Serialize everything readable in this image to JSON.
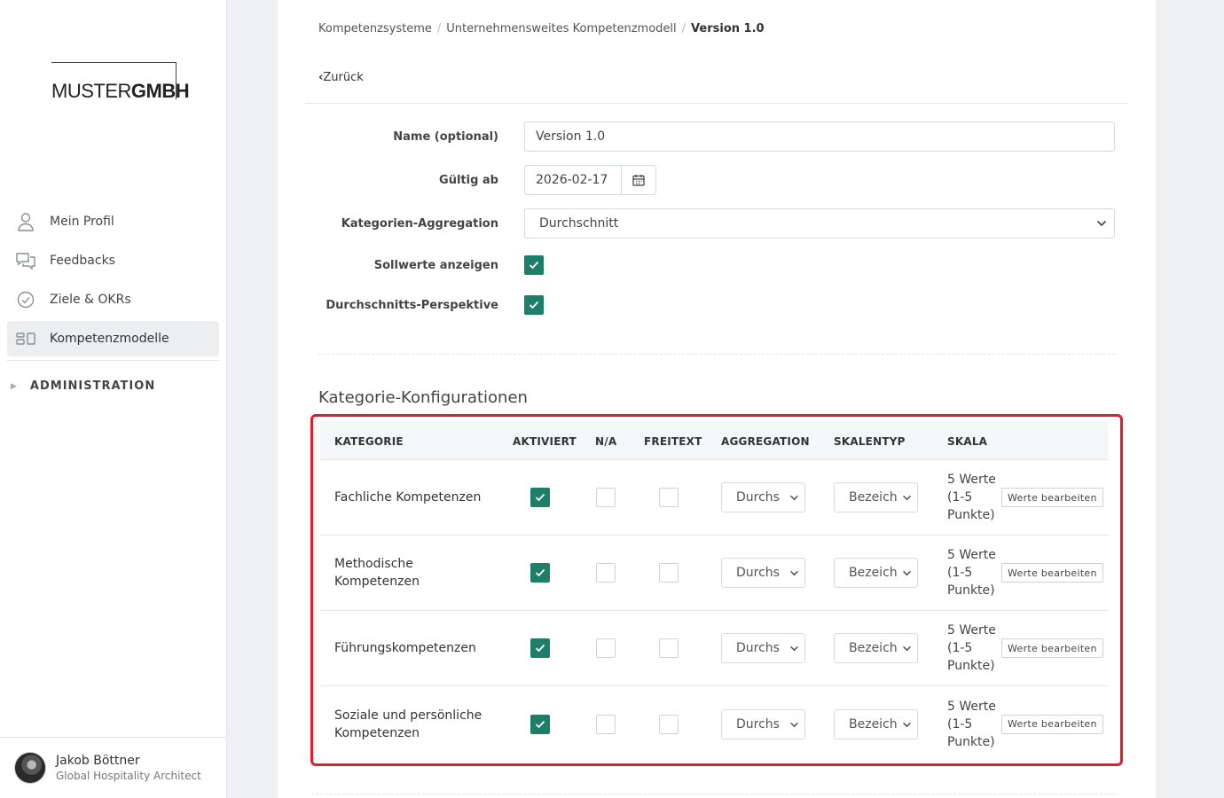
{
  "sidebar": {
    "logo": {
      "light": "MUSTER",
      "bold": "GMBH"
    },
    "items": [
      {
        "label": "Mein Profil",
        "icon": "user-icon"
      },
      {
        "label": "Feedbacks",
        "icon": "chat-icon"
      },
      {
        "label": "Ziele & OKRs",
        "icon": "check-circle-icon"
      },
      {
        "label": "Kompetenzmodelle",
        "icon": "model-icon",
        "active": true
      }
    ],
    "admin_label": "ADMINISTRATION",
    "user": {
      "name": "Jakob Böttner",
      "role": "Global Hospitality Architect"
    }
  },
  "breadcrumb": {
    "items": [
      "Kompetenzsysteme",
      "Unternehmensweites Kompetenzmodell"
    ],
    "current": "Version 1.0"
  },
  "back_label": "Zurück",
  "form": {
    "name_label": "Name (optional)",
    "name_value": "Version 1.0",
    "valid_label": "Gültig ab",
    "valid_value": "2026-02-17",
    "agg_label": "Kategorien-Aggregation",
    "agg_value": "Durchschnitt",
    "sollwerte_label": "Sollwerte anzeigen",
    "sollwerte_checked": true,
    "perspektive_label": "Durchschnitts-Perspektive",
    "perspektive_checked": true
  },
  "section_title": "Kategorie-Konfigurationen",
  "table": {
    "headers": {
      "kategorie": "KATEGORIE",
      "aktiviert": "AKTIVIERT",
      "na": "N/A",
      "freitext": "FREITEXT",
      "aggregation": "AGGREGATION",
      "skalentyp": "SKALENTYP",
      "skala": "SKALA"
    },
    "rows": [
      {
        "name": "Fachliche Kompetenzen",
        "aktiviert": true,
        "na": false,
        "freitext": false,
        "aggregation": "Durchs",
        "skalentyp": "Bezeich",
        "skala": "5 Werte (1-5 Punkte)",
        "edit": "Werte bearbeiten"
      },
      {
        "name": "Methodische Kompetenzen",
        "aktiviert": true,
        "na": false,
        "freitext": false,
        "aggregation": "Durchs",
        "skalentyp": "Bezeich",
        "skala": "5 Werte (1-5 Punkte)",
        "edit": "Werte bearbeiten"
      },
      {
        "name": "Führungskompetenzen",
        "aktiviert": true,
        "na": false,
        "freitext": false,
        "aggregation": "Durchs",
        "skalentyp": "Bezeich",
        "skala": "5 Werte (1-5 Punkte)",
        "edit": "Werte bearbeiten"
      },
      {
        "name": "Soziale und persönliche Kompetenzen",
        "aktiviert": true,
        "na": false,
        "freitext": false,
        "aggregation": "Durchs",
        "skalentyp": "Bezeich",
        "skala": "5 Werte (1-5 Punkte)",
        "edit": "Werte bearbeiten"
      }
    ]
  },
  "colors": {
    "accent": "#1e7e6a",
    "highlight": "#e11d2b"
  }
}
